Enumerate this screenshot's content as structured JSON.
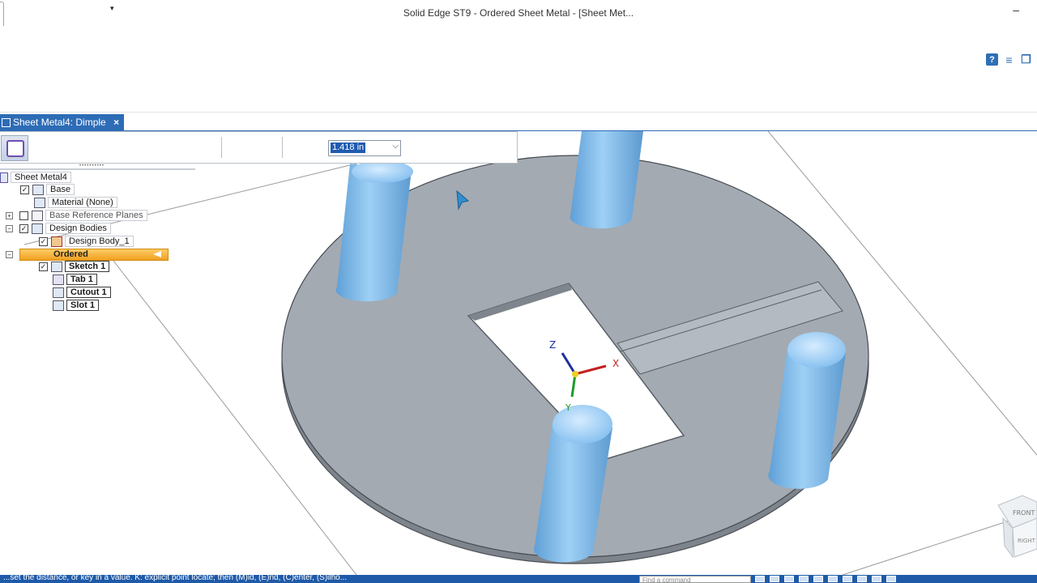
{
  "app": {
    "title": "Solid Edge ST9 - Ordered Sheet Metal - [Sheet Met...",
    "qa_dropdown_glyph": "▾",
    "minimize_glyph": "–"
  },
  "help": {
    "help_label": "?"
  },
  "document_tab": {
    "label": "Sheet Metal4: Dimple",
    "close_glyph": "×"
  },
  "command_bar": {
    "dimension_value": "1.418 in",
    "dropdown_glyph": "⌵"
  },
  "pathfinder": {
    "root": "Sheet Metal4",
    "base": "Base",
    "material": "Material (None)",
    "base_reference_planes": "Base Reference Planes",
    "design_bodies": "Design Bodies",
    "design_body_1": "Design Body_1",
    "ordered": "Ordered",
    "sketch_1": "Sketch 1",
    "tab_1": "Tab 1",
    "cutout_1": "Cutout 1",
    "slot_1": "Slot 1",
    "expand_plus": "+",
    "expand_minus": "−",
    "check": "✓"
  },
  "view_cube": {
    "front": "FRONT",
    "right": "RIGHT"
  },
  "triad": {
    "x": "X",
    "y": "Y",
    "z": "Z"
  },
  "status": {
    "message": "...set the distance, or key in a value. K: explicit point locate; then (M)id, (E)nd, (C)enter, (S)ilho...",
    "find_placeholder": "Find a command"
  },
  "colors": {
    "accent": "#2d6cb6",
    "plate": "#a3aab2",
    "boss": "#7fbbe8",
    "ordered_highlight": "#f0a020"
  },
  "icons": [
    "help-icon",
    "ribbon-options-icon",
    "window-arrange-icon",
    "close-icon",
    "checkbox-icon",
    "expand-icon",
    "collapse-icon",
    "sketch-icon",
    "tab-feature-icon",
    "cutout-icon",
    "slot-icon",
    "material-icon",
    "design-body-icon",
    "cursor-icon"
  ]
}
